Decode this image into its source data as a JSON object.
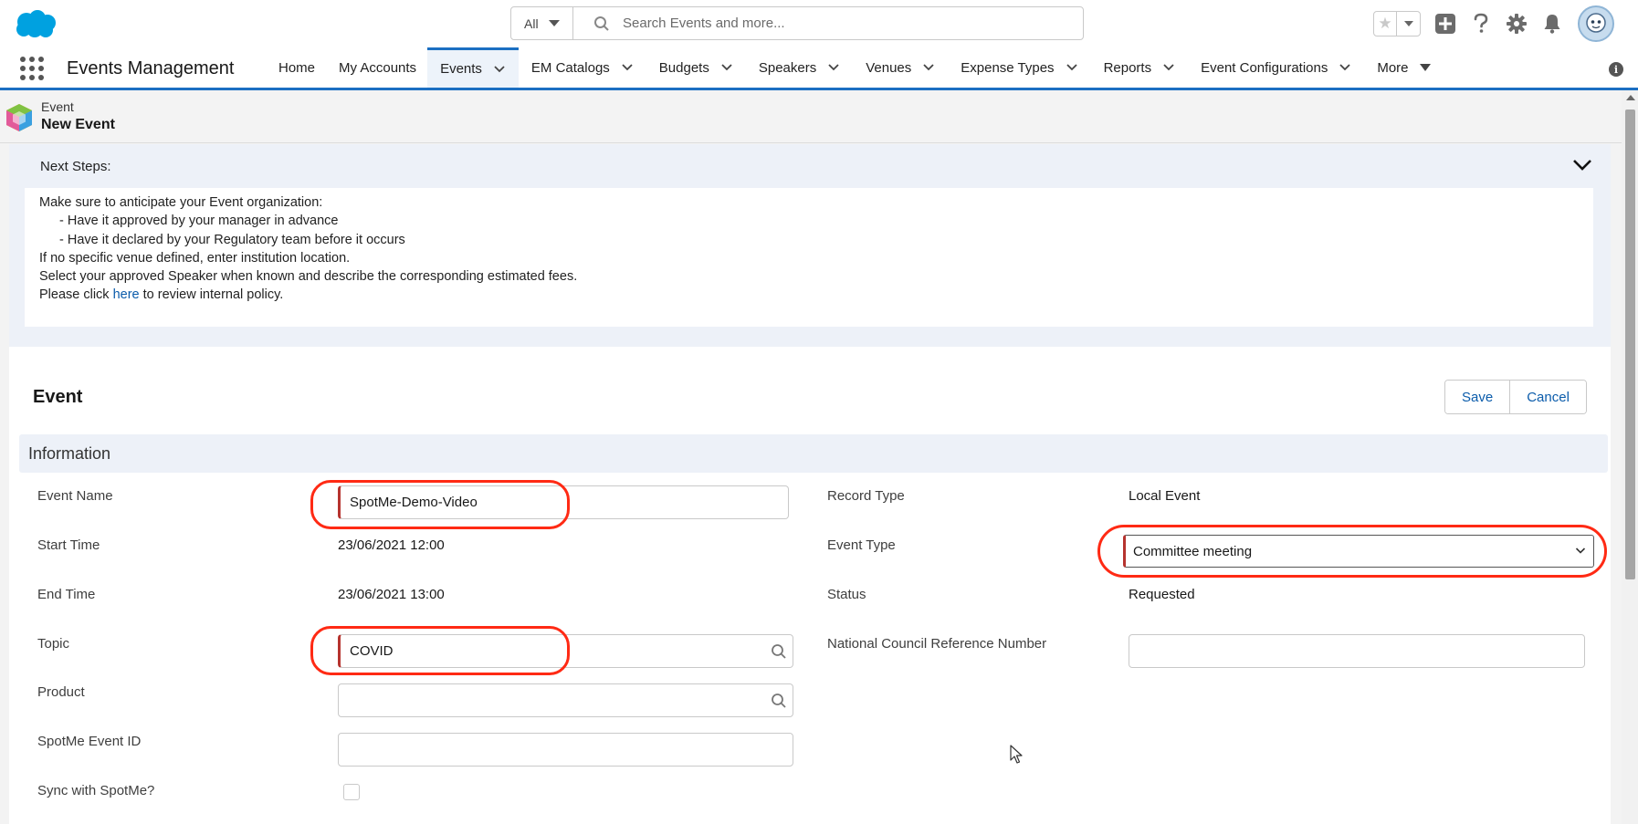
{
  "search": {
    "scope": "All",
    "placeholder": "Search Events and more..."
  },
  "nav": {
    "app_name": "Events Management",
    "items": [
      {
        "label": "Home"
      },
      {
        "label": "My Accounts"
      },
      {
        "label": "Events"
      },
      {
        "label": "EM Catalogs"
      },
      {
        "label": "Budgets"
      },
      {
        "label": "Speakers"
      },
      {
        "label": "Venues"
      },
      {
        "label": "Expense Types"
      },
      {
        "label": "Reports"
      },
      {
        "label": "Event Configurations"
      },
      {
        "label": "More"
      }
    ],
    "active_item": "Events"
  },
  "record": {
    "object": "Event",
    "title": "New Event"
  },
  "next_steps": {
    "header": "Next Steps:",
    "lines": [
      "Make sure to anticipate your Event organization:",
      "- Have it approved by your manager in advance",
      "- Have it declared by your Regulatory team before it occurs",
      "If no specific venue defined, enter institution location.",
      "Select your approved Speaker when known and describe the corresponding estimated fees."
    ],
    "policy_prefix": "Please click",
    "policy_link": "here",
    "policy_suffix": "to review internal policy."
  },
  "form": {
    "title": "Event",
    "save_label": "Save",
    "cancel_label": "Cancel",
    "section_title": "Information",
    "fields": {
      "event_name": {
        "label": "Event Name",
        "value": "SpotMe-Demo-Video"
      },
      "start_time": {
        "label": "Start Time",
        "value": "23/06/2021 12:00"
      },
      "end_time": {
        "label": "End Time",
        "value": "23/06/2021 13:00"
      },
      "topic": {
        "label": "Topic",
        "value": "COVID"
      },
      "product": {
        "label": "Product",
        "value": ""
      },
      "spotme_event_id": {
        "label": "SpotMe Event ID",
        "value": ""
      },
      "sync_spotme": {
        "label": "Sync with SpotMe?",
        "checked": false
      },
      "record_type": {
        "label": "Record Type",
        "value": "Local Event"
      },
      "event_type": {
        "label": "Event Type",
        "value": "Committee meeting"
      },
      "status": {
        "label": "Status",
        "value": "Requested"
      },
      "ncrn": {
        "label": "National Council Reference Number",
        "value": ""
      }
    }
  },
  "colors": {
    "brand_blue": "#1b6fc2",
    "link_blue": "#0b5cab",
    "required_bar": "#b6332e",
    "annotation_red": "#ff2a14"
  }
}
